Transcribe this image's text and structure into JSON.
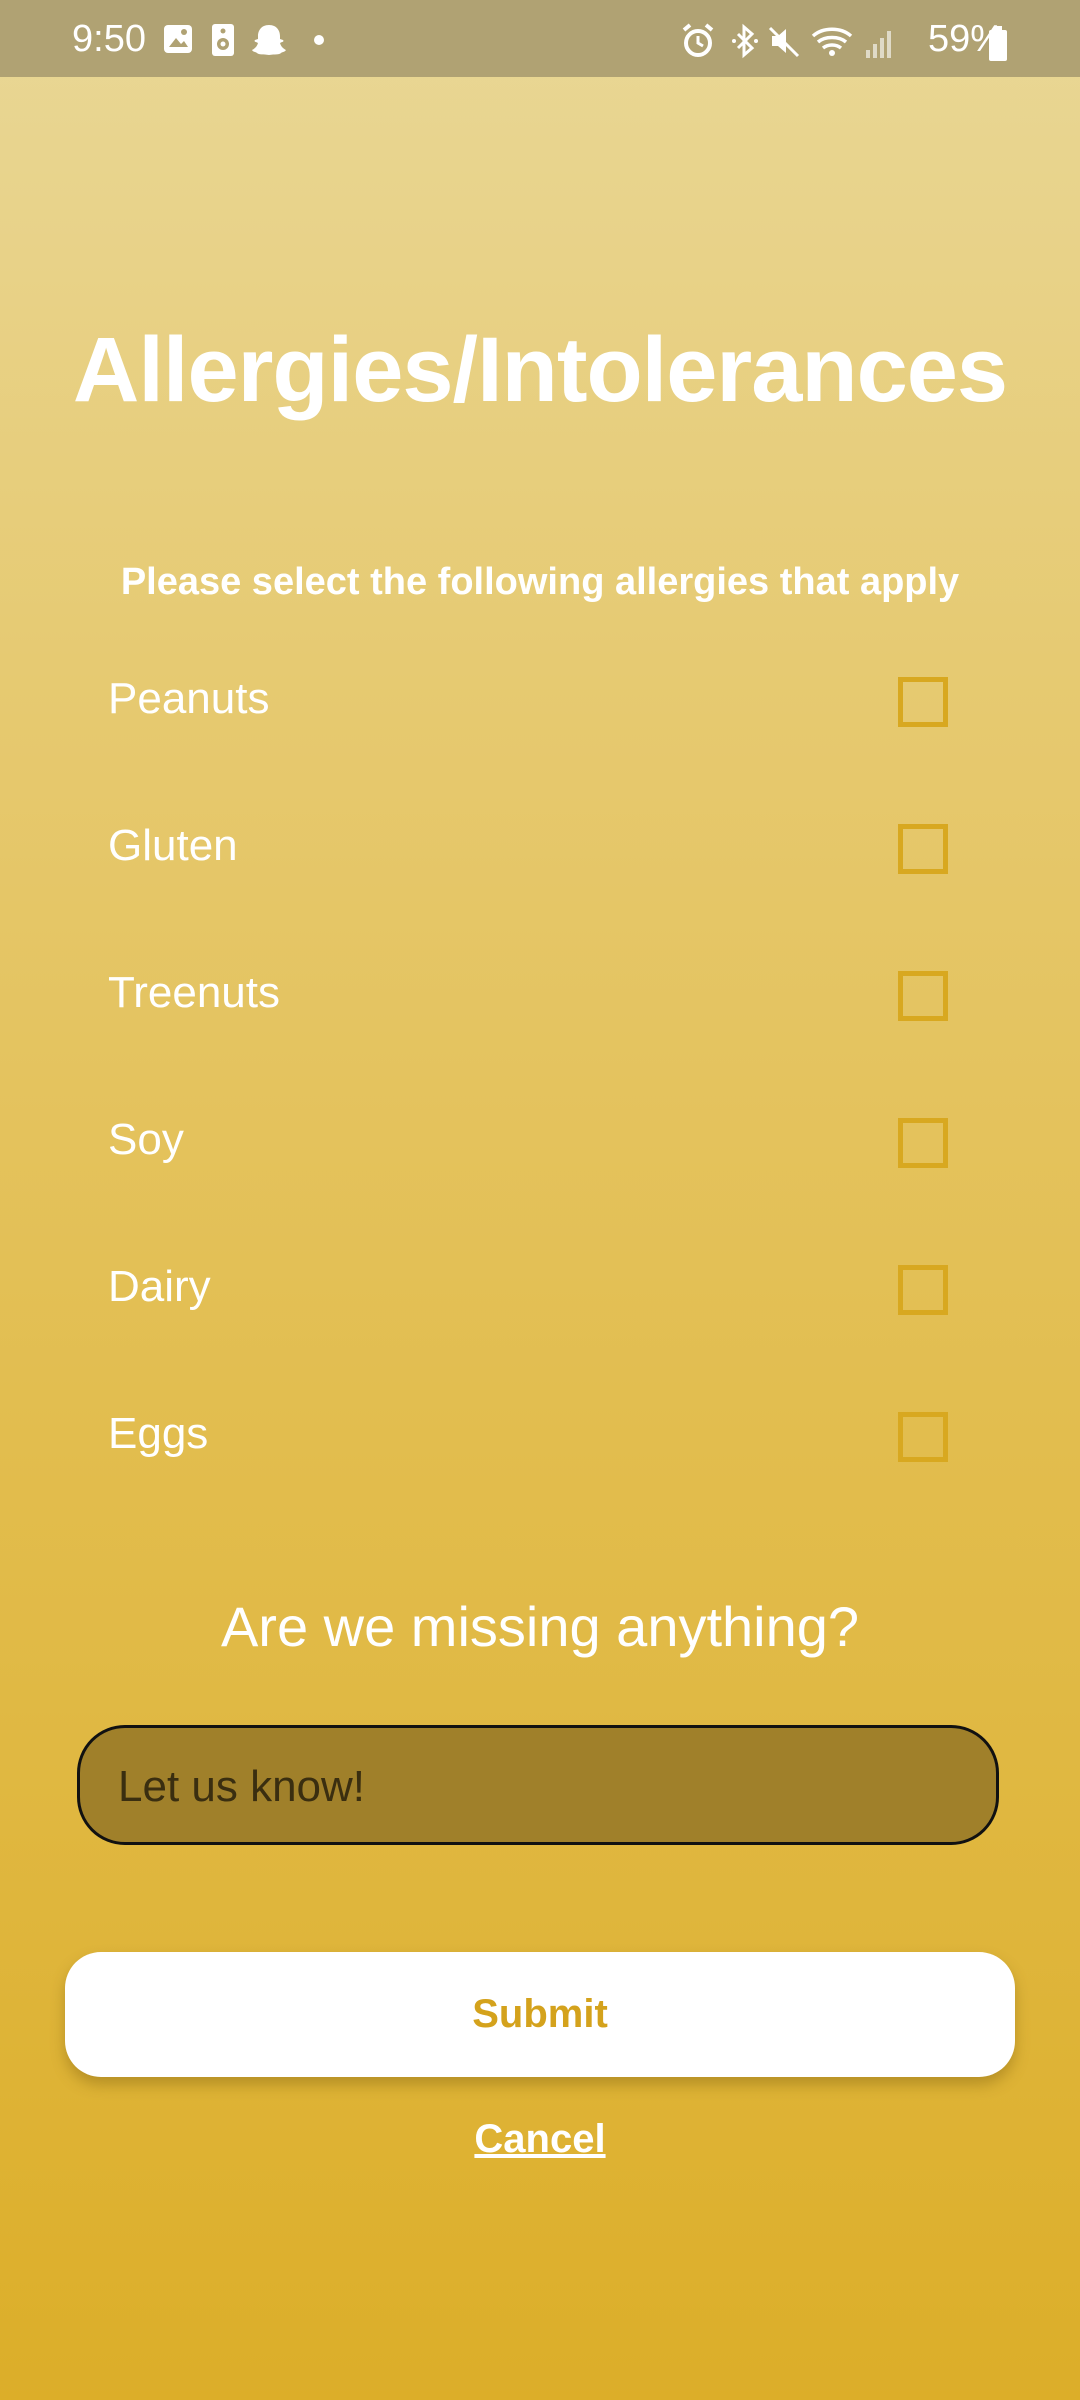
{
  "status_bar": {
    "time": "9:50",
    "battery": "59%",
    "left_icons": [
      "gallery-icon",
      "speaker-icon",
      "snapchat-icon",
      "dot-icon"
    ],
    "right_icons": [
      "alarm-icon",
      "bluetooth-icon",
      "mute-icon",
      "wifi-icon",
      "signal-icon",
      "battery-icon"
    ]
  },
  "title": "Allergies/Intolerances",
  "subtitle": "Please select the following allergies that apply",
  "options": [
    {
      "label": "Peanuts",
      "checked": false
    },
    {
      "label": "Gluten",
      "checked": false
    },
    {
      "label": "Treenuts",
      "checked": false
    },
    {
      "label": "Soy",
      "checked": false
    },
    {
      "label": "Dairy",
      "checked": false
    },
    {
      "label": "Eggs",
      "checked": false
    }
  ],
  "missing": {
    "question": "Are we missing anything?",
    "placeholder": "Let us know!",
    "value": ""
  },
  "actions": {
    "submit_label": "Submit",
    "cancel_label": "Cancel"
  },
  "colors": {
    "accent": "#d4a21c",
    "status_bar": "#b0a273",
    "input_fill": "#a0802a"
  }
}
